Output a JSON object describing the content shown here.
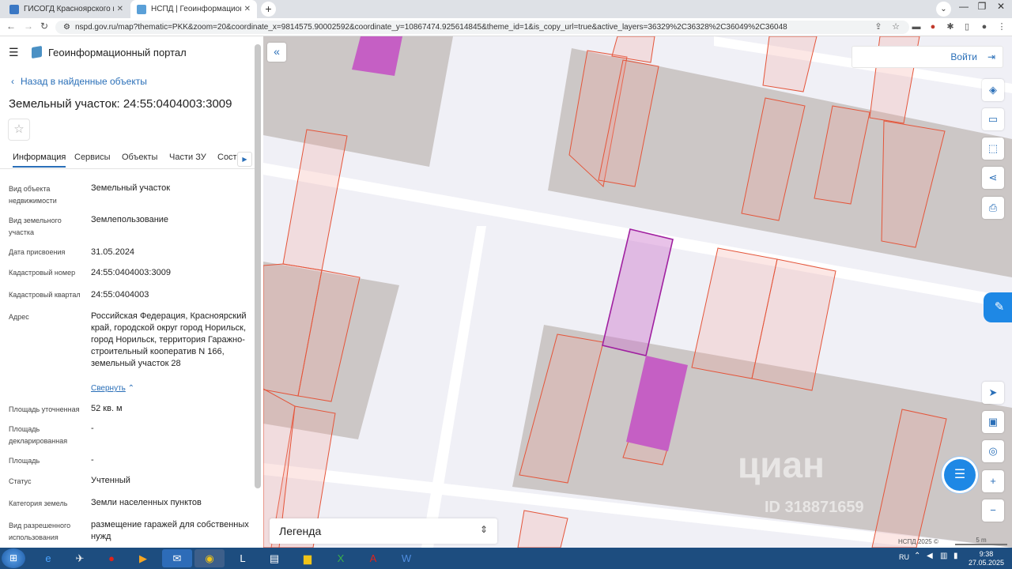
{
  "browser": {
    "tabs": [
      {
        "title": "ГИСОГД Красноярского края",
        "active": false
      },
      {
        "title": "НСПД | Геоинформационный п...",
        "active": true
      }
    ],
    "new_tab": "+",
    "url": "nspd.gov.ru/map?thematic=PKK&zoom=20&coordinate_x=9814575.90002592&coordinate_y=10867474.925614845&theme_id=1&is_copy_url=true&active_layers=36329%2C36328%2C36049%2C36048"
  },
  "sidebar": {
    "portal_title": "Геоинформационный портал",
    "back_link": "Назад в найденные объекты",
    "object_title": "Земельный участок: 24:55:0404003:3009",
    "tabs": [
      {
        "label": "Информация",
        "selected": true
      },
      {
        "label": "Сервисы",
        "selected": false
      },
      {
        "label": "Объекты",
        "selected": false
      },
      {
        "label": "Части ЗУ",
        "selected": false
      },
      {
        "label": "Соста",
        "selected": false
      }
    ],
    "fields": [
      {
        "label": "Вид объекта недвижимости",
        "value": "Земельный участок"
      },
      {
        "label": "Вид земельного участка",
        "value": "Землепользование"
      },
      {
        "label": "Дата присвоения",
        "value": "31.05.2024"
      },
      {
        "label": "Кадастровый номер",
        "value": "24:55:0404003:3009"
      },
      {
        "label": "Кадастровый квартал",
        "value": "24:55:0404003"
      },
      {
        "label": "Адрес",
        "value": "Российская Федерация, Красноярский край, городской округ город Норильск, город Норильск, территория Гаражно-строительный кооператив N 166, земельный участок 28"
      },
      {
        "label": "Площадь уточненная",
        "value": "52 кв. м"
      },
      {
        "label": "Площадь декларированная",
        "value": "-"
      },
      {
        "label": "Площадь",
        "value": "-"
      },
      {
        "label": "Статус",
        "value": "Учтенный"
      },
      {
        "label": "Категория земель",
        "value": "Земли населенных пунктов"
      },
      {
        "label": "Вид разрешенного использования",
        "value": "размещение гаражей для собственных нужд"
      }
    ],
    "collapse_link": "Свернуть"
  },
  "map": {
    "login_label": "Войти",
    "legend_label": "Легенда",
    "attribution": "НСПД 2025 ©",
    "scale_label": "5 m",
    "watermark": "циан",
    "watermark_id": "ID 318871659",
    "colors": {
      "selected_fill": "#c55fc4",
      "parcel_stroke": "#e4553a",
      "building": "#ccc7c6"
    }
  },
  "taskbar": {
    "lang": "RU",
    "time": "9:38",
    "date": "27.05.2025"
  }
}
